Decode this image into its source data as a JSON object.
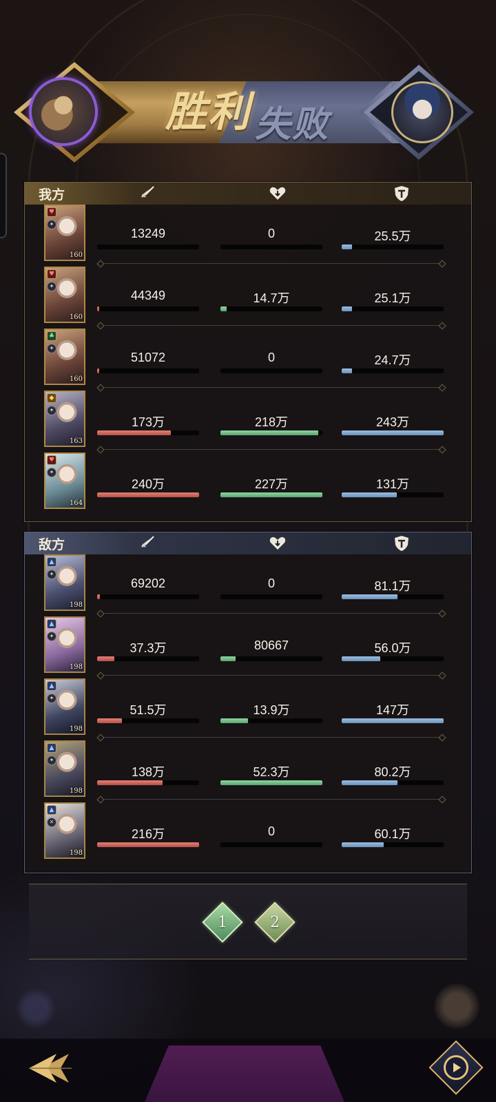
{
  "banner": {
    "win_text": "胜利",
    "lose_text": "失败"
  },
  "mine": {
    "label": "我方",
    "rows": [
      {
        "level": "160",
        "damage": "13249",
        "damage_pct": 0,
        "heal": "0",
        "heal_pct": 0,
        "tank": "25.5万",
        "tank_pct": 0.1
      },
      {
        "level": "160",
        "damage": "44349",
        "damage_pct": 0.02,
        "heal": "14.7万",
        "heal_pct": 0.06,
        "tank": "25.1万",
        "tank_pct": 0.1
      },
      {
        "level": "160",
        "damage": "51072",
        "damage_pct": 0.02,
        "heal": "0",
        "heal_pct": 0,
        "tank": "24.7万",
        "tank_pct": 0.1
      },
      {
        "level": "163",
        "damage": "173万",
        "damage_pct": 0.72,
        "heal": "218万",
        "heal_pct": 0.96,
        "tank": "243万",
        "tank_pct": 1.0
      },
      {
        "level": "164",
        "damage": "240万",
        "damage_pct": 1.0,
        "heal": "227万",
        "heal_pct": 1.0,
        "tank": "131万",
        "tank_pct": 0.54
      }
    ]
  },
  "enemy": {
    "label": "敌方",
    "rows": [
      {
        "level": "198",
        "damage": "69202",
        "damage_pct": 0.03,
        "heal": "0",
        "heal_pct": 0,
        "tank": "81.1万",
        "tank_pct": 0.55
      },
      {
        "level": "198",
        "damage": "37.3万",
        "damage_pct": 0.17,
        "heal": "80667",
        "heal_pct": 0.15,
        "tank": "56.0万",
        "tank_pct": 0.38
      },
      {
        "level": "198",
        "damage": "51.5万",
        "damage_pct": 0.24,
        "heal": "13.9万",
        "heal_pct": 0.27,
        "tank": "147万",
        "tank_pct": 1.0
      },
      {
        "level": "198",
        "damage": "138万",
        "damage_pct": 0.64,
        "heal": "52.3万",
        "heal_pct": 1.0,
        "tank": "80.2万",
        "tank_pct": 0.55
      },
      {
        "level": "198",
        "damage": "216万",
        "damage_pct": 1.0,
        "heal": "0",
        "heal_pct": 0,
        "tank": "60.1万",
        "tank_pct": 0.41
      }
    ]
  },
  "rounds": [
    "1",
    "2"
  ],
  "colors": {
    "damage": "#c95e56",
    "heal": "#76c08b",
    "tank": "#7fa6cf",
    "gold": "#c6a061",
    "confirm": "#7a2a80"
  },
  "icons": {
    "damage": "sword-icon",
    "heal": "heart-icon",
    "tank": "shield-icon",
    "back": "back-arrow-icon",
    "replay": "replay-icon"
  }
}
